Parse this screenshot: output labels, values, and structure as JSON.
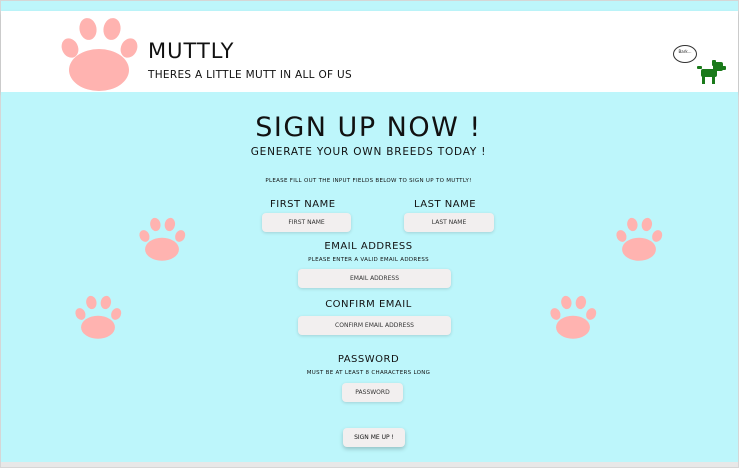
{
  "header": {
    "brand_name": "MUTTLY",
    "tagline": "THERES A LITTLE MUTT IN ALL OF US",
    "mascot_speech": "Bark..."
  },
  "signup": {
    "heading": "SIGN UP NOW !",
    "subheading": "GENERATE YOUR OWN BREEDS TODAY !",
    "instructions": "PLEASE FILL OUT THE INPUT FIELDS BELOW TO SIGN UP TO MUTTLY!",
    "first_name": {
      "label": "FIRST NAME",
      "placeholder": "FIRST NAME"
    },
    "last_name": {
      "label": "LAST NAME",
      "placeholder": "LAST NAME"
    },
    "email": {
      "label": "EMAIL ADDRESS",
      "hint": "PLEASE ENTER A VALID EMAIL ADDRESS",
      "placeholder": "EMAIL ADDRESS"
    },
    "confirm_email": {
      "label": "CONFIRM EMAIL",
      "placeholder": "CONFIRM EMAIL ADDRESS"
    },
    "password": {
      "label": "PASSWORD",
      "hint": "MUST BE AT LEAST 8 CHARACTERS LONG",
      "placeholder": "PASSWORD"
    },
    "submit_label": "SIGN ME UP !"
  },
  "colors": {
    "background": "#bdf6fb",
    "header_background": "#ffffff",
    "paw": "#ffb3b0",
    "mascot": "#1a7a1a",
    "input_background": "#f2efef"
  },
  "icons": [
    "paw-logo-icon",
    "paw-print-icon",
    "dog-mascot-icon",
    "speech-bubble-icon"
  ]
}
